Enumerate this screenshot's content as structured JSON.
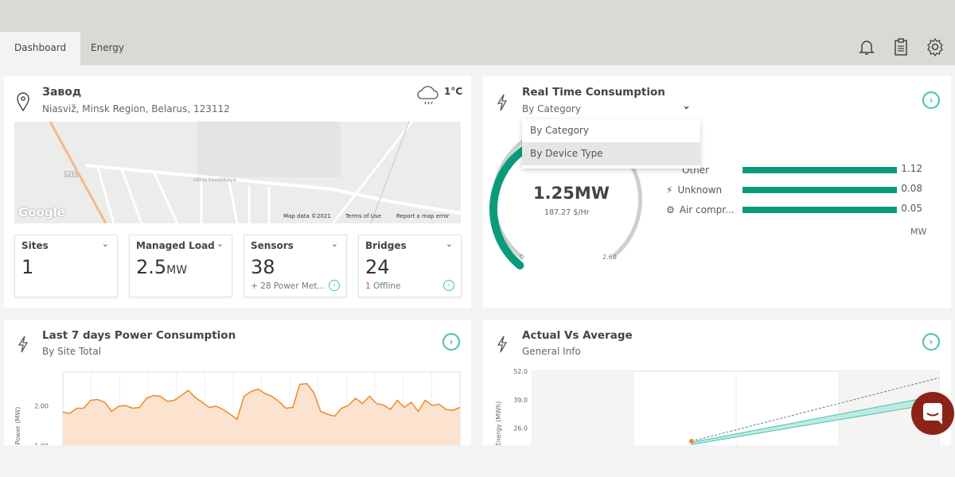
{
  "tabs": [
    {
      "label": "Dashboard",
      "active": true
    },
    {
      "label": "Energy",
      "active": false
    }
  ],
  "toolbar_icons": [
    "bell-icon",
    "clipboard-icon",
    "gear-icon"
  ],
  "site": {
    "name": "Завод",
    "address": "Niasviž, Minsk Region, Belarus, 123112",
    "weather": {
      "temp": "1°C",
      "icon": "rain-cloud-icon"
    },
    "map": {
      "logo": "Google",
      "road_label": "P11",
      "street": "Ulitsa Sovetskaya",
      "attribution": "Map data ©2021",
      "terms": "Terms of Use",
      "report": "Report a map error"
    }
  },
  "stats": [
    {
      "label": "Sites",
      "value": "1",
      "unit": "",
      "note": ""
    },
    {
      "label": "Managed Load",
      "value": "2.5",
      "unit": "MW",
      "note": ""
    },
    {
      "label": "Sensors",
      "value": "38",
      "unit": "",
      "note": "+ 28 Power Met..."
    },
    {
      "label": "Bridges",
      "value": "24",
      "unit": "",
      "note_count": "1",
      "note": "Offline"
    }
  ],
  "realtime": {
    "title": "Real Time Consumption",
    "selected": "By Category",
    "options": [
      "By Category",
      "By Device Type"
    ],
    "highlighted": "By Device Type",
    "gauge": {
      "value": "1.25MW",
      "cost": "187.27 $/Hr",
      "min": "0",
      "max": "2.60",
      "fraction": 0.48
    },
    "rows": [
      {
        "label": "Other",
        "value": "1.12",
        "icon": "tag-icon"
      },
      {
        "label": "Unknown",
        "value": "0.08",
        "icon": "plug-icon"
      },
      {
        "label": "Air compr...",
        "value": "0.05",
        "icon": "gears-icon"
      }
    ],
    "unit": "MW",
    "accent": "#0a9b7d"
  },
  "power": {
    "title": "Last 7 days Power Consumption",
    "subtitle": "By Site Total"
  },
  "actual": {
    "title": "Actual Vs Average",
    "subtitle": "General Info"
  },
  "chart_data": [
    {
      "type": "area",
      "ylabel": "Power (MW)",
      "yticks": [
        "2.00",
        "1.00"
      ],
      "ylim": [
        0.95,
        2.85
      ],
      "color": "#f08a24",
      "values": [
        1.8,
        1.85,
        1.9,
        1.98,
        2.1,
        2.2,
        2.05,
        1.9,
        1.95,
        2.05,
        1.9,
        2.0,
        2.15,
        2.3,
        2.2,
        2.15,
        2.1,
        2.3,
        2.35,
        2.25,
        2.05,
        2.0,
        1.95,
        1.95,
        1.75,
        1.7,
        2.2,
        2.4,
        2.38,
        2.35,
        2.2,
        2.15,
        1.9,
        2.0,
        2.5,
        2.6,
        2.3,
        1.9,
        1.75,
        1.78,
        1.9,
        2.05,
        2.15,
        2.1,
        2.2,
        2.1,
        1.98,
        1.95,
        2.1,
        2.0,
        2.05,
        1.9,
        2.1,
        2.05,
        2.0,
        1.95,
        1.85,
        2.0
      ]
    },
    {
      "type": "line",
      "ylabel": "Energy (MWh)",
      "yticks": [
        "52.0",
        "39.0",
        "26.0"
      ],
      "ylim": [
        18,
        52
      ],
      "series": [
        {
          "style": "dashed",
          "color": "#6b7a8a",
          "start": 20,
          "end": 49
        },
        {
          "style": "band",
          "color": "#45c3ad",
          "start_low": 18.5,
          "start_high": 19.5,
          "end_low": 37.5,
          "end_high": 41
        }
      ],
      "point": {
        "value": 20,
        "color": "#f08a24"
      }
    }
  ]
}
